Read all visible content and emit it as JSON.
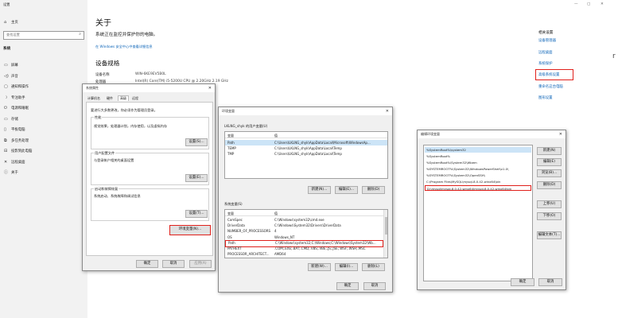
{
  "settings": {
    "window_title": "设置",
    "window_buttons": [
      "—",
      "▢",
      "✕"
    ],
    "home": "主页",
    "search_placeholder": "查找设置",
    "section": "系统",
    "nav": [
      {
        "icon": "display-icon",
        "glyph": "▭",
        "label": "屏幕"
      },
      {
        "icon": "sound-icon",
        "glyph": "◁)",
        "label": "声音"
      },
      {
        "icon": "notification-icon",
        "glyph": "▢",
        "label": "通知和操作"
      },
      {
        "icon": "focus-icon",
        "glyph": "☽",
        "label": "专注助手"
      },
      {
        "icon": "power-icon",
        "glyph": "⏻",
        "label": "电源和睡眠"
      },
      {
        "icon": "storage-icon",
        "glyph": "▭",
        "label": "存储"
      },
      {
        "icon": "tablet-icon",
        "glyph": "▯",
        "label": "平板电脑"
      },
      {
        "icon": "multitask-icon",
        "glyph": "⧉",
        "label": "多任务处理"
      },
      {
        "icon": "project-icon",
        "glyph": "⊟",
        "label": "投影到此电脑"
      },
      {
        "icon": "remote-icon",
        "glyph": "✕",
        "label": "远程桌面"
      },
      {
        "icon": "info-icon",
        "glyph": "ⓘ",
        "label": "关于"
      }
    ],
    "about_title": "关于",
    "protect_text": "系统正在监控并保护你的电脑。",
    "security_link": "在 Windows 安全中心中查看详细信息",
    "spec_title": "设备规格",
    "device_name_label": "设备名称",
    "device_name": "WIN-6KE9EV5B0L",
    "processor_label": "处理器",
    "processor": "Intel(R) Core(TM) i5-5200U CPU @ 2.20GHz   2.19 GHz",
    "related_title": "相关设置",
    "related_links": [
      "设备管理器",
      "远程桌面",
      "系统保护",
      "高级系统设置",
      "重命名这台电脑",
      "图形设置"
    ],
    "highlighted_link": "高级系统设置"
  },
  "sysprops": {
    "title": "系统属性",
    "tabs": [
      "计算机名",
      "硬件",
      "高级",
      "远程"
    ],
    "active_tab": "高级",
    "admin_note": "要进行大多数更改，你必须作为管理员登录。",
    "perf_title": "性能",
    "perf_desc": "视觉效果，处理器计划，内存使用，以及虚拟内存",
    "settings_btn": "设置(S)...",
    "profile_title": "用户配置文件",
    "profile_desc": "与登录帐户相关的桌面设置",
    "settings_btn2": "设置(E)...",
    "startup_title": "启动和故障恢复",
    "startup_desc": "系统启动、系统故障和调试信息",
    "settings_btn3": "设置(T)...",
    "env_btn": "环境变量(N)...",
    "ok": "确定",
    "cancel": "取消",
    "apply": "应用(A)"
  },
  "envvars": {
    "title": "环境变量",
    "user_group": "LKLNG_shyk 的用户变量(U)",
    "col_var": "变量",
    "col_val": "值",
    "user_vars": [
      {
        "name": "Path",
        "value": "C:\\Users\\LKLNG_shyk\\AppData\\Local\\Microsoft\\WindowsAp..."
      },
      {
        "name": "TEMP",
        "value": "C:\\Users\\LKLNG_shyk\\AppData\\Local\\Temp"
      },
      {
        "name": "TMP",
        "value": "C:\\Users\\LKLNG_shyk\\AppData\\Local\\Temp"
      }
    ],
    "new_btn": "新建(N)...",
    "edit_btn": "编辑(E)...",
    "delete_btn": "删除(D)",
    "sys_group": "系统变量(S)",
    "sys_vars": [
      {
        "name": "ComSpec",
        "value": "C:\\Windows\\system32\\cmd.exe"
      },
      {
        "name": "DriverData",
        "value": "C:\\Windows\\System32\\Drivers\\DriverData"
      },
      {
        "name": "NUMBER_OF_PROCESSORS",
        "value": "4"
      },
      {
        "name": "OS",
        "value": "Windows_NT"
      },
      {
        "name": "Path",
        "value": "C:\\Windows\\system32;C:\\Windows;C:\\Windows\\System32\\Wb..."
      },
      {
        "name": "PATHEXT",
        "value": ".COM;.EXE;.BAT;.CMD;.VBS;.VBE;.JS;.JSE;.WSF;.WSH;.MSC"
      },
      {
        "name": "PROCESSOR_ARCHITECT...",
        "value": "AMD64"
      }
    ],
    "new_btn2": "新建(W)...",
    "edit_btn2": "编辑(I)...",
    "delete_btn2": "删除(L)",
    "ok": "确定",
    "cancel": "取消"
  },
  "editenv": {
    "title": "编辑环境变量",
    "entries": [
      "%SystemRoot%\\system32",
      "%SystemRoot%",
      "%SystemRoot%\\System32\\Wbem",
      "%SYSTEMROOT%\\System32\\WindowsPowerShell\\v1.0\\",
      "%SYSTEMROOT%\\System32\\OpenSSH\\",
      "C:\\Program Files\\MySQL\\mysql-8.0.42-winx64\\bin",
      "D:\\mysql\\mysql-8.0.42-winx64\\mysql-8.0.42-winx64\\bin"
    ],
    "buttons": [
      "新建(N)",
      "编辑(E)",
      "浏览(B)...",
      "删除(D)",
      "上移(U)",
      "下移(O)",
      "编辑文本(T)..."
    ],
    "ok": "确定",
    "cancel": "取消"
  }
}
